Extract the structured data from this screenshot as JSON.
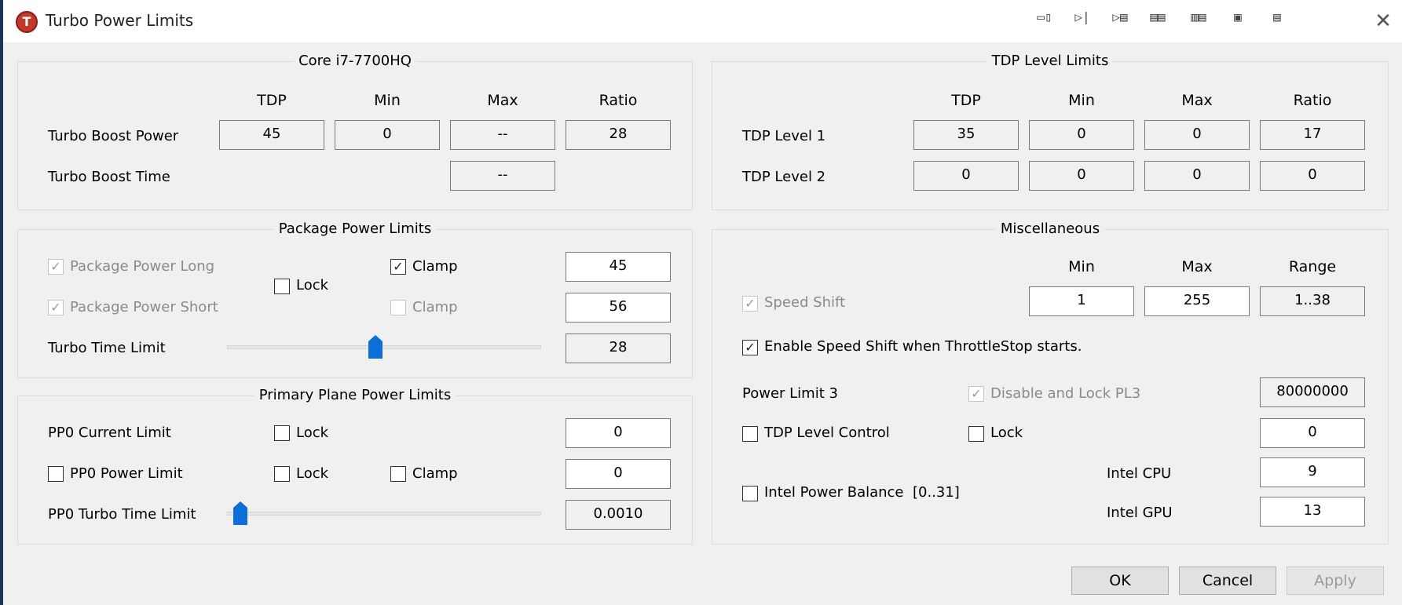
{
  "window": {
    "title": "Turbo Power Limits",
    "app_icon_letter": "T",
    "toolbar_icons": [
      "panel-icon",
      "step-icon",
      "step-list-icon",
      "grid-icon",
      "grid-alt-icon",
      "save-icon",
      "delete-icon"
    ],
    "toolbar_glyphs": [
      "▭▯",
      "▷|",
      "▷▤",
      "▤▤",
      "▥▤",
      "▣",
      "▤"
    ],
    "close_glyph": "✕"
  },
  "cpu_group": {
    "legend": "Core i7-7700HQ",
    "headers": [
      "TDP",
      "Min",
      "Max",
      "Ratio"
    ],
    "turbo_boost_power": {
      "label": "Turbo Boost Power",
      "values": [
        "45",
        "0",
        "--",
        "28"
      ]
    },
    "turbo_boost_time": {
      "label": "Turbo Boost Time",
      "value": "--"
    }
  },
  "tdp_group": {
    "legend": "TDP Level Limits",
    "headers": [
      "TDP",
      "Min",
      "Max",
      "Ratio"
    ],
    "level1": {
      "label": "TDP Level 1",
      "values": [
        "35",
        "0",
        "0",
        "17"
      ]
    },
    "level2": {
      "label": "TDP Level 2",
      "values": [
        "0",
        "0",
        "0",
        "0"
      ]
    }
  },
  "package_group": {
    "legend": "Package Power Limits",
    "long": {
      "label": "Package Power Long",
      "checked": true,
      "value": "45"
    },
    "short": {
      "label": "Package Power Short",
      "checked": true,
      "value": "56"
    },
    "lock_label": "Lock",
    "clamp1_label": "Clamp",
    "clamp2_label": "Clamp",
    "turbo_time": {
      "label": "Turbo Time Limit",
      "value": "28",
      "slider_fraction": 0.47
    }
  },
  "misc_group": {
    "legend": "Miscellaneous",
    "headers": [
      "Min",
      "Max",
      "Range"
    ],
    "speed_shift": {
      "label": "Speed Shift",
      "min": "1",
      "max": "255",
      "range": "1..38"
    },
    "enable_speed_shift": {
      "label": "Enable Speed Shift when ThrottleStop starts.",
      "checked": true
    },
    "power_limit3": {
      "label": "Power Limit 3",
      "disable_lock_label": "Disable and Lock PL3",
      "value": "80000000"
    },
    "tdp_level_control": {
      "label": "TDP Level Control",
      "lock_label": "Lock",
      "value": "0"
    },
    "power_balance": {
      "label": "Intel Power Balance",
      "range": "[0..31]",
      "cpu_label": "Intel CPU",
      "cpu_value": "9",
      "gpu_label": "Intel GPU",
      "gpu_value": "13"
    }
  },
  "primary_plane_group": {
    "legend": "Primary Plane Power Limits",
    "current": {
      "label": "PP0 Current Limit",
      "lock_label": "Lock",
      "value": "0"
    },
    "power": {
      "label": "PP0 Power Limit",
      "lock_label": "Lock",
      "clamp_label": "Clamp",
      "value": "0"
    },
    "turbo_time": {
      "label": "PP0 Turbo Time Limit",
      "value": "0.0010",
      "slider_fraction": 0.02
    }
  },
  "buttons": {
    "ok": "OK",
    "cancel": "Cancel",
    "apply": "Apply"
  },
  "colors": {
    "accent": "#0a6fd6",
    "app_icon": "#c0392b"
  },
  "check_glyph": "✓"
}
